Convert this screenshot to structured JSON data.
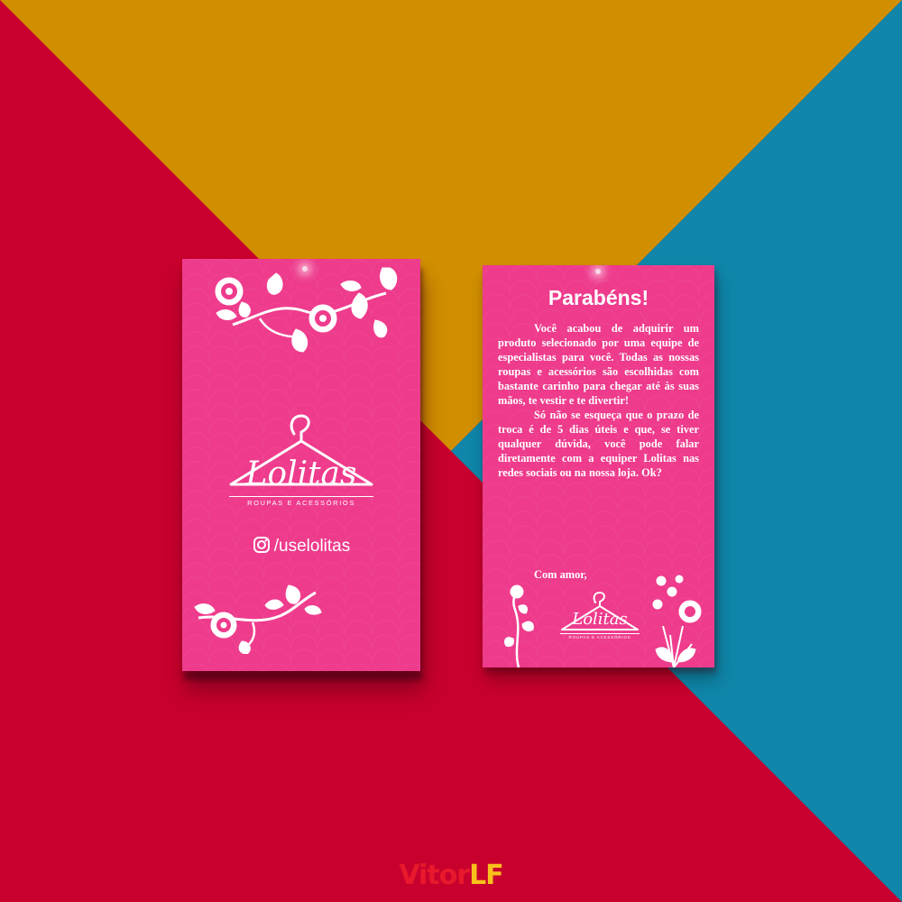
{
  "colors": {
    "background_red": "#c8002d",
    "background_gold": "#d18f00",
    "background_teal": "#0f86a9",
    "card_pink": "#ee3b8c",
    "ink_white": "#ffffff"
  },
  "front_card": {
    "brand": "Lolitas",
    "tagline": "ROUPAS E ACESSÓRIOS",
    "instagram_handle": "/uselolitas",
    "icons": [
      "floral-ornament-top",
      "hanger-logo-icon",
      "instagram-icon",
      "floral-ornament-bottom"
    ]
  },
  "back_card": {
    "title": "Parabéns!",
    "paragraphs": [
      "Você acabou de adquirir um produto selecionado por uma equipe de especialistas para você. Todas as nossas roupas e acessórios são escolhidas com bastante carinho para chegar até às suas mãos, te vestir e te divertir!",
      "Só não se esqueça que o prazo de troca é de 5 dias úteis e que, se tiver qualquer dúvida, você pode falar diretamente com a equiper Lolitas nas redes sociais ou na nossa loja. Ok?"
    ],
    "signoff": "Com amor,",
    "brand": "Lolitas",
    "tagline": "ROUPAS E ACESSÓRIOS",
    "icons": [
      "flower-sprig-left",
      "hanger-logo-icon",
      "flower-bouquet-right"
    ]
  },
  "watermark": {
    "part1": "Vitor",
    "part2": "LF"
  }
}
